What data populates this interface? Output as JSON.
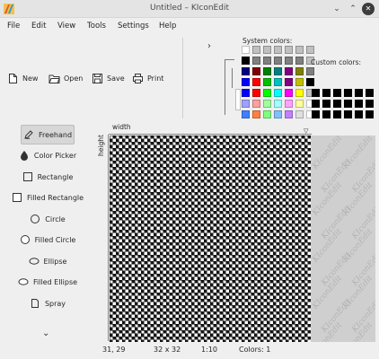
{
  "window": {
    "title": "Untitled – KIconEdit",
    "minimize_glyph": "⌄",
    "maximize_glyph": "⌃",
    "close_glyph": "✕"
  },
  "menu": {
    "items": [
      "File",
      "Edit",
      "View",
      "Tools",
      "Settings",
      "Help"
    ]
  },
  "toolbar": {
    "new_label": "New",
    "open_label": "Open",
    "save_label": "Save",
    "print_label": "Print",
    "expand_glyph": "›"
  },
  "palette": {
    "system_label": "System colors:",
    "custom_label": "Custom colors:",
    "system_colors": [
      "#ffffff",
      "#c0c0c0",
      "#c0c0c0",
      "#c0c0c0",
      "#c0c0c0",
      "#c0c0c0",
      "#c0c0c0",
      "#000000",
      "#808080",
      "#808080",
      "#808080",
      "#808080",
      "#808080",
      "#c0c0c0",
      "#000080",
      "#800000",
      "#008000",
      "#008080",
      "#800080",
      "#808000",
      "#808080",
      "#0000ff",
      "#ff0000",
      "#00c000",
      "#00c0c0",
      "#800080",
      "#c0c000",
      "#000000",
      "#0000ff",
      "#ff0000",
      "#00ff00",
      "#00ffff",
      "#ff00ff",
      "#ffff00",
      "#c0c0c0",
      "#a0a0ff",
      "#ffa0a0",
      "#a0ffa0",
      "#a0ffff",
      "#ffa0ff",
      "#ffffa0",
      "#ffffff",
      "#4080ff",
      "#ff8040",
      "#80ff80",
      "#80c0ff",
      "#c080ff",
      "#e0e0e0",
      "#ffffff"
    ],
    "custom_colors_count": 18,
    "custom_color": "#000000"
  },
  "tools": {
    "items": [
      {
        "label": "Freehand",
        "icon": "pencil-icon",
        "active": true
      },
      {
        "label": "Color Picker",
        "icon": "dropper-icon",
        "active": false
      },
      {
        "label": "Rectangle",
        "icon": "rectangle-icon",
        "active": false
      },
      {
        "label": "Filled Rectangle",
        "icon": "filled-rectangle-icon",
        "active": false
      },
      {
        "label": "Circle",
        "icon": "circle-icon",
        "active": false
      },
      {
        "label": "Filled Circle",
        "icon": "filled-circle-icon",
        "active": false
      },
      {
        "label": "Ellipse",
        "icon": "ellipse-icon",
        "active": false
      },
      {
        "label": "Filled Ellipse",
        "icon": "filled-ellipse-icon",
        "active": false
      },
      {
        "label": "Spray",
        "icon": "spray-icon",
        "active": false
      }
    ],
    "more_glyph": "⌄"
  },
  "canvas": {
    "width_label": "width",
    "height_label": "height",
    "watermark_text": "KIconEdit"
  },
  "status": {
    "cursor": "31, 29",
    "size": "32 x 32",
    "zoom": "1:10",
    "colors": "Colors: 1"
  }
}
